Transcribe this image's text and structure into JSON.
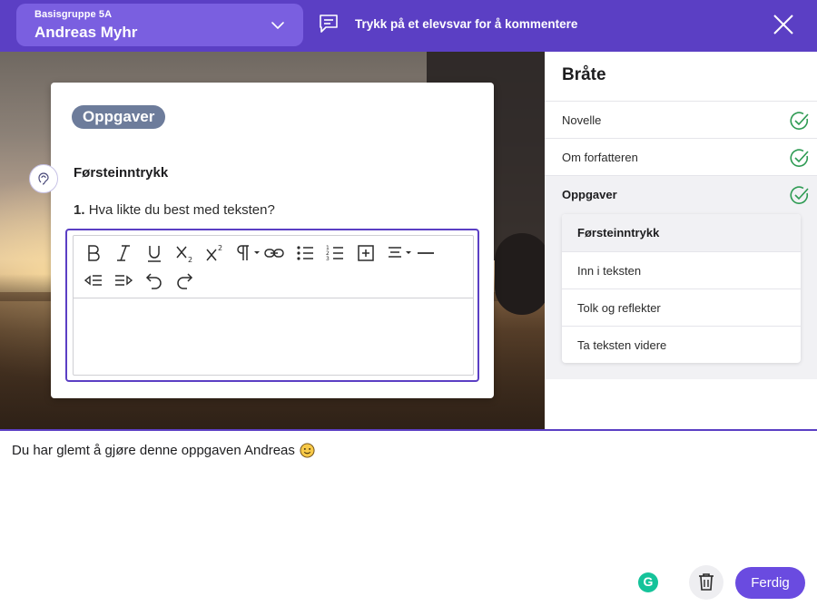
{
  "header": {
    "group_name": "Basisgruppe 5A",
    "student_name": "Andreas Myhr",
    "comment_hint": "Trykk på et elevsvar for å kommentere",
    "icons": [
      "chevron-down-icon",
      "comment-icon",
      "close-icon"
    ]
  },
  "task": {
    "category_pill": "Oppgaver",
    "section_title": "Førsteinntrykk",
    "question_number": "1.",
    "question_text": "Hva likte du best med teksten?",
    "editor_value": "",
    "toolbar_icons": [
      "bold-icon",
      "italic-icon",
      "underline-icon",
      "subscript-icon",
      "superscript-icon",
      "paragraph-icon",
      "link-icon",
      "bullet-list-icon",
      "numbered-list-icon",
      "insert-table-icon",
      "align-center-icon",
      "horizontal-rule-icon",
      "outdent-icon",
      "indent-icon",
      "undo-icon",
      "redo-icon"
    ]
  },
  "sidebar": {
    "title": "Bråte",
    "items": [
      {
        "label": "Novelle",
        "completed": true
      },
      {
        "label": "Om forfatteren",
        "completed": true
      },
      {
        "label": "Oppgaver",
        "completed": true
      }
    ],
    "subitems": [
      {
        "label": "Førsteinntrykk"
      },
      {
        "label": "Inn i teksten"
      },
      {
        "label": "Tolk og reflekter"
      },
      {
        "label": "Ta teksten videre"
      }
    ]
  },
  "comment": {
    "text": "Du har glemt å gjøre denne oppgaven Andreas",
    "emoji": "slightly-smiling-face"
  },
  "actions": {
    "grammarly_label": "G",
    "done_label": "Ferdig"
  },
  "colors": {
    "brand_purple": "#5b3fc4",
    "button_purple": "#6a4be0",
    "pill_gray_blue": "#6d7c9b",
    "check_green": "#2e9b53"
  }
}
